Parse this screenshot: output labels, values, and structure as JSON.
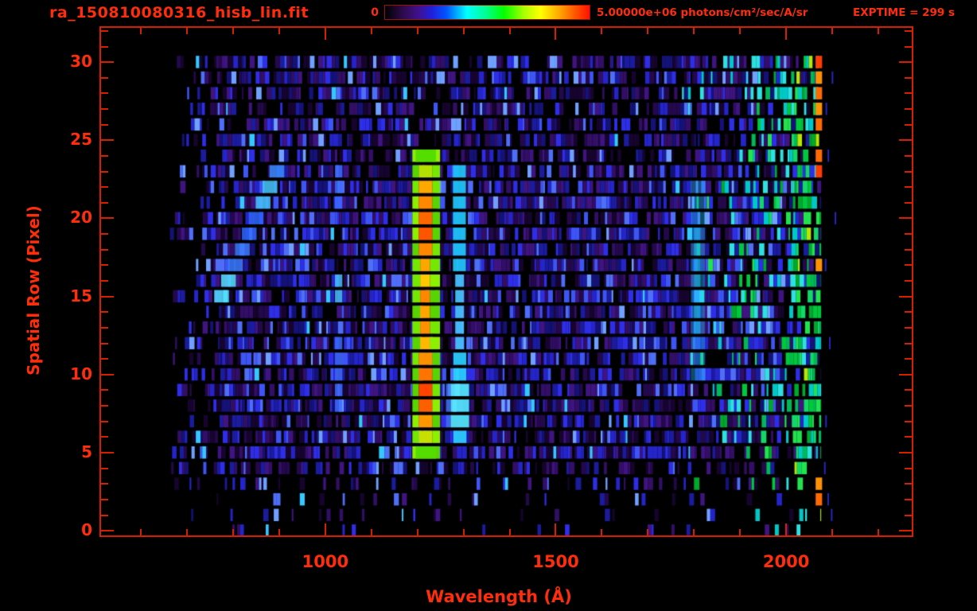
{
  "header": {
    "title": "ra_150810080316_hisb_lin.fit",
    "colorbar_min_label": "0",
    "colorbar_max_label": "5.00000e+06 photons/cm²/sec/A/sr",
    "exptime_label": "EXPTIME = 299 s"
  },
  "axes": {
    "x_title": "Wavelength (Å)",
    "y_title": "Spatial Row (Pixel)"
  },
  "colors": {
    "background": "#000000",
    "text_red": "#ff2d0c",
    "line_red": "#d81e00"
  },
  "chart_data": {
    "type": "heatmap",
    "title": "ra_150810080316_hisb_lin.fit",
    "xlabel": "Wavelength (Å)",
    "ylabel": "Spatial Row (Pixel)",
    "x_range": [
      510,
      2276
    ],
    "y_range": [
      -0.4,
      32.3
    ],
    "x_tick_labels": [
      1000,
      1500,
      2000
    ],
    "x_minor_step": 100,
    "y_tick_labels": [
      0,
      5,
      10,
      15,
      20,
      25,
      30
    ],
    "y_minor_step": 1,
    "spatial_rows": 31,
    "data_wavelength_extent": [
      662,
      2076
    ],
    "exposure_seconds": 299,
    "colorbar": {
      "min": 0,
      "max": 5000000,
      "units": "photons/cm²/sec/A/sr",
      "colormap": "rainbow-black-to-red",
      "stops": [
        {
          "p": 0.0,
          "c": "#000000"
        },
        {
          "p": 0.08,
          "c": "#2a0a45"
        },
        {
          "p": 0.16,
          "c": "#41108a"
        },
        {
          "p": 0.23,
          "c": "#2020dd"
        },
        {
          "p": 0.3,
          "c": "#0055ff"
        },
        {
          "p": 0.4,
          "c": "#00ffff"
        },
        {
          "p": 0.5,
          "c": "#00ff88"
        },
        {
          "p": 0.58,
          "c": "#00ff00"
        },
        {
          "p": 0.68,
          "c": "#aaff00"
        },
        {
          "p": 0.76,
          "c": "#ffff00"
        },
        {
          "p": 0.85,
          "c": "#ffaa00"
        },
        {
          "p": 0.93,
          "c": "#ff5500"
        },
        {
          "p": 1.0,
          "c": "#ff1100"
        }
      ]
    },
    "noise": {
      "seed": 150810,
      "left_edge_wl": 662,
      "right_edge_wl": 2076,
      "left_sparse_until_wl": 762,
      "ramp_start_wl": 1764,
      "band_wl": [
        2012,
        2076
      ],
      "row_density": [
        0.06,
        0.1,
        0.14,
        0.32,
        0.5,
        0.8,
        0.8,
        0.8,
        0.8,
        0.82,
        0.84,
        0.84,
        0.84,
        0.84,
        0.84,
        0.84,
        0.84,
        0.84,
        0.82,
        0.82,
        0.82,
        0.82,
        0.8,
        0.8,
        0.72,
        0.7,
        0.7,
        0.7,
        0.72,
        0.78,
        0.78
      ],
      "purples": [
        "#16042e",
        "#24084c",
        "#320e66",
        "#3f1480"
      ],
      "blues": [
        "#141277",
        "#1b1b9e",
        "#2424c8",
        "#2e2ee8"
      ],
      "bright_blues": [
        "#3d55f5",
        "#4e6ef8"
      ],
      "light_blue": "#6fa0ff",
      "cyan": "#35c8ff",
      "band_greens": [
        "#00a82e",
        "#00c83c",
        "#22e24e",
        "#12d868",
        "#00b858"
      ],
      "band_cyans": [
        "#00c8c8",
        "#2ee0e0"
      ],
      "band_yellow": "#b8e400"
    },
    "features": {
      "lyman_alpha": {
        "rows": [
          5,
          24
        ],
        "core_wl": [
          1203,
          1232
        ],
        "core_narrow_wl": [
          1206,
          1227
        ],
        "narrow_rows": [
          12,
          17
        ],
        "core_colors_by_row": [
          "#63d800",
          "#c8e000",
          "#ff9800",
          "#ff5f00",
          "#ff4300",
          "#ff7300",
          "#ff9100",
          "#ffb800",
          "#ff9100",
          "#ffa500",
          "#ff8700",
          "#ffc800",
          "#ffa500",
          "#ff8700",
          "#ff5500",
          "#ff6600",
          "#ff8800",
          "#ffa800",
          "#b4e000",
          "#4fd800"
        ],
        "flank_left_wl": [
          1189,
          1203
        ],
        "flank_right_wl": [
          1232,
          1249
        ],
        "flank_colors": [
          "#58d400",
          "#74e800",
          "#8cf000"
        ],
        "cap_wl": [
          1196,
          1240
        ],
        "cap_color": "#55dd00"
      },
      "secondary_line": {
        "segments": [
          {
            "rows": [
              7,
              9
            ],
            "wl": [
              1272,
              1312
            ],
            "color": "#55e8ff"
          },
          {
            "rows": [
              6,
              6
            ],
            "wl": [
              1278,
              1306
            ],
            "color": "#2ad0ff"
          },
          {
            "rows": [
              10,
              11
            ],
            "wl": [
              1278,
              1306
            ],
            "color": "#2ad0ff"
          },
          {
            "rows": [
              12,
              16
            ],
            "wl": [
              1282,
              1301
            ],
            "color": "#49c4ff"
          },
          {
            "rows": [
              17,
              23
            ],
            "wl": [
              1277,
              1305
            ],
            "color": "#1fc8f8"
          }
        ],
        "fringe": {
          "rows": [
            7,
            9
          ],
          "wl": [
            1262,
            1272
          ],
          "color": "#3f7bff"
        }
      },
      "diagonal_streak": {
        "row_start": 15,
        "row_end": 23,
        "wl_at_start": 775,
        "wl_per_row": 15,
        "half_width_wl": 16,
        "colors_by_row": [
          "#55e0ff",
          "#55e0ff",
          "#3a7bff",
          "#3a7bff",
          "#2e66ff",
          "#2e66ff",
          "#49c8ff",
          "#49c8ff",
          "#3a8cff"
        ]
      },
      "blue_strand_column": {
        "wl": [
          1021,
          1037
        ],
        "row_groups": [
          [
            8,
            12
          ],
          [
            15,
            16
          ],
          [
            21,
            23
          ]
        ],
        "colors": [
          "#3d6bff",
          "#49c0ff"
        ]
      },
      "faint_cyan_streak": {
        "wl": [
          1793,
          1824
        ],
        "rows": [
          10,
          22
        ],
        "color": "#22c8ff",
        "alpha": 0.38,
        "core_wl": [
          1800,
          1814
        ],
        "core_rows": [
          13,
          19
        ],
        "core_alpha": 0.55
      },
      "hot_right_edge": {
        "wl": [
          2064,
          2078
        ],
        "row_groups": [
          [
            2,
            3
          ],
          [
            17,
            17
          ],
          [
            23,
            24
          ],
          [
            26,
            27
          ],
          [
            28,
            30
          ]
        ],
        "colors": [
          "#ff9100",
          "#ff3c00",
          "#ff6a00"
        ]
      },
      "stray_strands": {
        "wl_range": [
          2080,
          2106
        ],
        "rows": [
          1,
          2,
          4,
          7,
          12,
          17,
          20,
          24,
          27,
          29
        ],
        "color": "#2a2ad0"
      }
    }
  }
}
